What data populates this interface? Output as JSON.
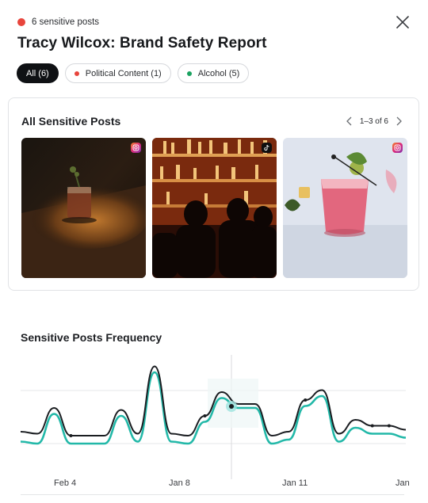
{
  "header": {
    "badge_text": "6 sensitive posts",
    "badge_color": "#e8453c",
    "title": "Tracy Wilcox: Brand Safety Report"
  },
  "filters": [
    {
      "label": "All (6)",
      "active": true
    },
    {
      "label": "Political Content (1)",
      "dot_color": "#e8453c",
      "active": false
    },
    {
      "label": "Alcohol (5)",
      "dot_color": "#1aa260",
      "active": false
    }
  ],
  "posts_panel": {
    "title": "All Sensitive Posts",
    "pager_text": "1–3 of 6",
    "posts": [
      {
        "platform": "instagram-icon",
        "subject": "cocktail on bar counter in sunlight"
      },
      {
        "platform": "tiktok-icon",
        "subject": "crowd in front of lit bar shelves"
      },
      {
        "platform": "instagram-icon",
        "subject": "pink cocktail with cucumber garnish"
      }
    ]
  },
  "frequency_chart": {
    "title": "Sensitive Posts Frequency"
  },
  "chart_data": {
    "type": "line",
    "title": "Sensitive Posts Frequency",
    "x_tick_labels": [
      "Feb 4",
      "Jan 8",
      "Jan 11",
      "Jan"
    ],
    "series": [
      {
        "color": "#1a1d21",
        "values": [
          1.2,
          1.1,
          2.4,
          1.0,
          1.0,
          1.0,
          2.3,
          1.1,
          4.5,
          1.1,
          1.0,
          2.0,
          3.2,
          2.6,
          2.6,
          1.0,
          1.2,
          2.8,
          3.3,
          1.1,
          1.8,
          1.5,
          1.5,
          1.3
        ]
      },
      {
        "color": "#22b8a8",
        "values": [
          0.7,
          0.6,
          2.1,
          0.6,
          0.6,
          0.6,
          2.0,
          0.7,
          4.2,
          0.7,
          0.6,
          1.7,
          2.9,
          2.4,
          2.4,
          0.6,
          0.8,
          2.5,
          3.0,
          0.7,
          1.4,
          1.1,
          1.1,
          0.9
        ]
      }
    ],
    "ylim": [
      0,
      5
    ],
    "grid": "horizontal"
  }
}
